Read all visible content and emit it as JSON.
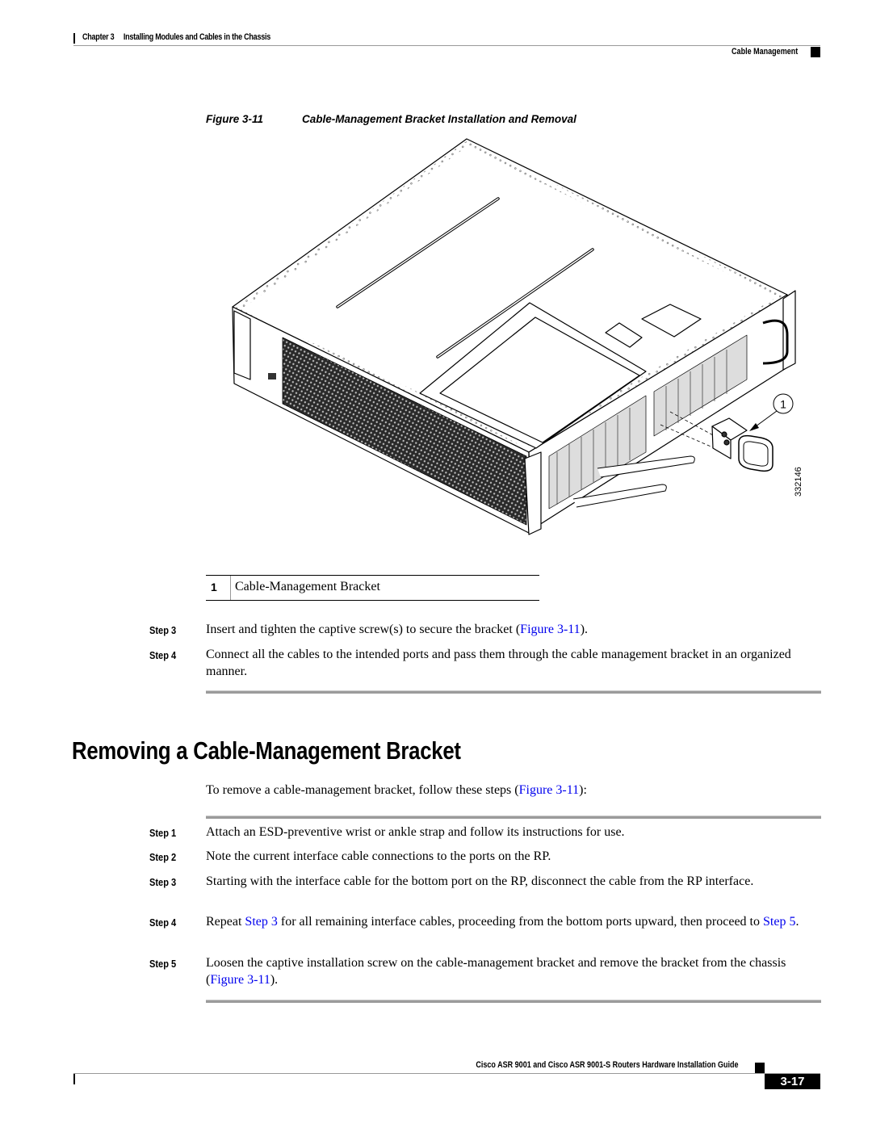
{
  "header": {
    "chapter": "Chapter 3",
    "chapter_title": "Installing Modules and Cables in the Chassis",
    "section": "Cable Management"
  },
  "figure": {
    "number": "Figure 3-11",
    "title": "Cable-Management Bracket Installation and Removal",
    "callout": "1",
    "image_id": "332146",
    "legend": [
      {
        "num": "1",
        "label": "Cable-Management Bracket"
      }
    ]
  },
  "install_steps": [
    {
      "label": "Step 3",
      "text_before": "Insert and tighten the captive screw(s) to secure the bracket (",
      "link": "Figure 3-11",
      "text_after": ")."
    },
    {
      "label": "Step 4",
      "text": "Connect all the cables to the intended ports and pass them through the cable management bracket in an organized manner."
    }
  ],
  "section": {
    "heading": "Removing a Cable-Management Bracket",
    "intro_before": "To remove a cable-management bracket, follow these steps (",
    "intro_link": "Figure 3-11",
    "intro_after": "):",
    "steps": [
      {
        "label": "Step 1",
        "text": "Attach an ESD-preventive wrist or ankle strap and follow its instructions for use."
      },
      {
        "label": "Step 2",
        "text": "Note the current interface cable connections to the ports on the RP."
      },
      {
        "label": "Step 3",
        "text": "Starting with the interface cable for the bottom port on the RP, disconnect the cable from the RP interface."
      },
      {
        "label": "Step 4",
        "pre": "Repeat ",
        "link1": "Step 3",
        "mid": " for all remaining interface cables, proceeding from the bottom ports upward, then proceed to ",
        "link2": "Step 5",
        "post": "."
      },
      {
        "label": "Step 5",
        "pre": "Loosen the captive installation screw on the cable-management bracket and remove the bracket from the chassis (",
        "link1": "Figure 3-11",
        "post": ")."
      }
    ]
  },
  "footer": {
    "guide_title": "Cisco ASR 9001 and Cisco ASR 9001-S Routers Hardware Installation Guide",
    "page": "3-17"
  },
  "colors": {
    "link": "#0000ee",
    "rule": "#9b9b9b"
  }
}
